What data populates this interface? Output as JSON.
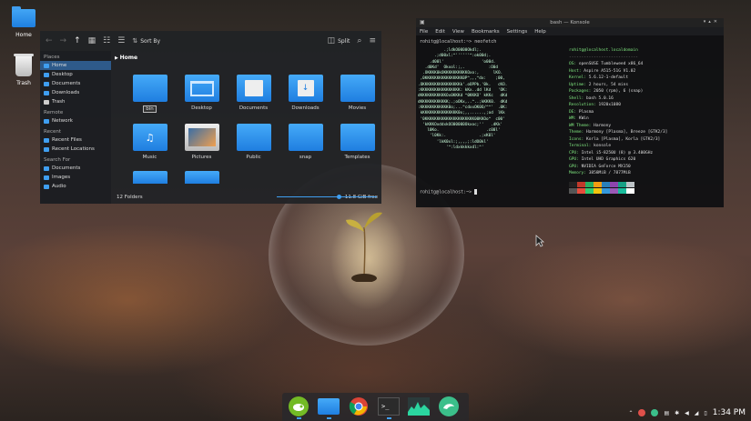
{
  "desktop": {
    "icons": [
      {
        "label": "Home"
      },
      {
        "label": "Trash"
      }
    ]
  },
  "file_manager": {
    "toolbar": {
      "sort_label": "Sort By",
      "split_label": "Split"
    },
    "sidebar": {
      "places_header": "Places",
      "places": [
        "Home",
        "Desktop",
        "Documents",
        "Downloads",
        "Trash"
      ],
      "remote_header": "Remote",
      "remote": [
        "Network"
      ],
      "recent_header": "Recent",
      "recent": [
        "Recent Files",
        "Recent Locations"
      ],
      "search_header": "Search For",
      "search": [
        "Documents",
        "Images",
        "Audio"
      ]
    },
    "breadcrumb": "Home",
    "folders": [
      "bin",
      "Desktop",
      "Documents",
      "Downloads",
      "Movies",
      "Music",
      "Pictures",
      "Public",
      "snap",
      "Templates"
    ],
    "status": {
      "count": "12 Folders",
      "free": "11.8 GiB free",
      "zoom_fraction": 0.62
    }
  },
  "terminal": {
    "title": "bash — Konsole",
    "menu": [
      "File",
      "Edit",
      "View",
      "Bookmarks",
      "Settings",
      "Help"
    ],
    "prompt1": "rohitg@localhost:~> neofetch",
    "prompt2": "rohitg@localhost:~>",
    "host_header": "rohitg@localhost.localdomain",
    "info": [
      {
        "k": "OS:",
        "v": "openSUSE Tumbleweed x86_64"
      },
      {
        "k": "Host:",
        "v": "Aspire A515-51G V1.02"
      },
      {
        "k": "Kernel:",
        "v": "5.6.12-1-default"
      },
      {
        "k": "Uptime:",
        "v": "2 hours, 54 mins"
      },
      {
        "k": "Packages:",
        "v": "2050 (rpm), 6 (snap)"
      },
      {
        "k": "Shell:",
        "v": "bash 5.0.16"
      },
      {
        "k": "Resolution:",
        "v": "1920x1080"
      },
      {
        "k": "DE:",
        "v": "Plasma"
      },
      {
        "k": "WM:",
        "v": "KWin"
      },
      {
        "k": "WM Theme:",
        "v": "Harmony"
      },
      {
        "k": "Theme:",
        "v": "Harmony [Plasma], Breeze [GTK2/3]"
      },
      {
        "k": "Icons:",
        "v": "Korla [Plasma], Korla [GTK2/3]"
      },
      {
        "k": "Terminal:",
        "v": "konsole"
      },
      {
        "k": "CPU:",
        "v": "Intel i5-8250U (8) @ 3.400GHz"
      },
      {
        "k": "GPU:",
        "v": "Intel UHD Graphics 620"
      },
      {
        "k": "GPU:",
        "v": "NVIDIA GeForce MX150"
      },
      {
        "k": "Memory:",
        "v": "3858MiB / 7877MiB"
      }
    ],
    "palette": [
      "#222222",
      "#c0392b",
      "#27ae60",
      "#f39c12",
      "#2980b9",
      "#8e44ad",
      "#16a085",
      "#bdc3c7",
      "#555555",
      "#e74c3c",
      "#2ecc71",
      "#f1c40f",
      "#3498db",
      "#9b59b6",
      "#1abc9c",
      "#ffffff"
    ]
  },
  "taskbar": {
    "apps": [
      "opensuse-icon",
      "folder-icon",
      "chrome-icon",
      "terminal-icon",
      "system-monitor-icon",
      "gecko-icon"
    ],
    "clock": "1:34 PM"
  }
}
